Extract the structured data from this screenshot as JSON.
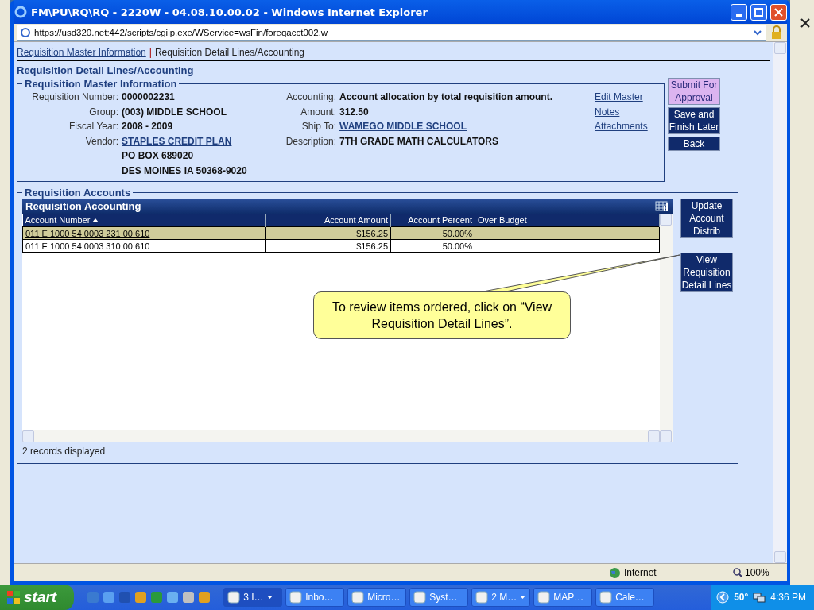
{
  "window": {
    "title": "FM\\PU\\RQ\\RQ - 2220W - 04.08.10.00.02 - Windows Internet Explorer"
  },
  "address": {
    "url": "https://usd320.net:442/scripts/cgiip.exe/WService=wsFin/foreqacct002.w"
  },
  "breadcrumb": {
    "separator": "|",
    "items": [
      {
        "label": "Requisition Master Information",
        "link": true
      },
      {
        "label": "Requisition Detail Lines/Accounting",
        "link": false
      }
    ]
  },
  "heading": "Requisition Detail Lines/Accounting",
  "master": {
    "legend": "Requisition Master Information",
    "left_fields": [
      {
        "label": "Requisition Number:",
        "values": [
          "0000002231"
        ],
        "kind": "text"
      },
      {
        "label": "Group:",
        "values": [
          "(003) MIDDLE SCHOOL"
        ],
        "kind": "text"
      },
      {
        "label": "Fiscal Year:",
        "values": [
          "2008 - 2009"
        ],
        "kind": "text"
      },
      {
        "label": "Vendor:",
        "values": [
          "STAPLES CREDIT PLAN",
          "PO BOX 689020",
          "DES MOINES IA 50368-9020"
        ],
        "kind": "link"
      }
    ],
    "right_fields": [
      {
        "label": "Accounting:",
        "values": [
          "Account allocation by total requisition amount."
        ],
        "kind": "text"
      },
      {
        "label": "Amount:",
        "values": [
          "312.50"
        ],
        "kind": "text"
      },
      {
        "label": "Ship To:",
        "values": [
          "WAMEGO MIDDLE SCHOOL"
        ],
        "kind": "link"
      },
      {
        "label": "Description:",
        "values": [
          "7TH GRADE MATH CALCULATORS"
        ],
        "kind": "text"
      }
    ],
    "links": [
      "Edit Master",
      "Notes",
      "Attachments"
    ],
    "buttons": [
      {
        "label": "Submit For Approval",
        "highlighted": true
      },
      {
        "label": "Save and Finish Later",
        "highlighted": false
      },
      {
        "label": "Back",
        "highlighted": false
      }
    ]
  },
  "accounts": {
    "legend": "Requisition Accounts",
    "grid_title": "Requisition Accounting",
    "columns": [
      {
        "label": "Account Number",
        "sorted": true,
        "kind": "text"
      },
      {
        "label": "Account Amount",
        "sorted": false,
        "kind": "number"
      },
      {
        "label": "Account Percent",
        "sorted": false,
        "kind": "number"
      },
      {
        "label": "Over Budget",
        "sorted": false,
        "kind": "text"
      }
    ],
    "rows": [
      {
        "cells": [
          "011 E 1000 54 0003 231 00 610",
          "$156.25",
          "50.00%"
        ],
        "selected": true
      },
      {
        "cells": [
          "011 E 1000 54 0003 310 00 610",
          "$156.25",
          "50.00%"
        ],
        "selected": false
      }
    ],
    "footer": "2 records displayed",
    "buttons": [
      {
        "label": "Update Account Distrib"
      },
      {
        "label": "View Requisition Detail Lines"
      }
    ]
  },
  "callout": {
    "text": "To review items ordered, click on “View Requisition Detail Lines”."
  },
  "status_bar": {
    "zone": "Internet",
    "zoom": "100%"
  },
  "taskbar": {
    "start": "start",
    "tasks": [
      {
        "label": "3 I…",
        "menu": true,
        "selected": true
      },
      {
        "label": "Inbo…",
        "menu": false,
        "selected": false
      },
      {
        "label": "Micro…",
        "menu": false,
        "selected": false
      },
      {
        "label": "Syst…",
        "menu": false,
        "selected": false
      },
      {
        "label": "2 M…",
        "menu": true,
        "selected": false
      },
      {
        "label": "MAP…",
        "menu": false,
        "selected": false
      },
      {
        "label": "Cale…",
        "menu": false,
        "selected": false
      }
    ],
    "temperature": "50°",
    "time": "4:36 PM"
  }
}
